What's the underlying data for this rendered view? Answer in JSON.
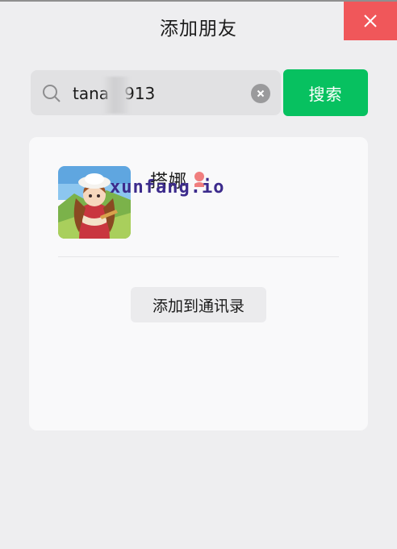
{
  "window": {
    "title": "添加朋友",
    "close_icon": "close-icon",
    "accent_close": "#f0575a"
  },
  "search": {
    "query": "tana   913",
    "button_label": "搜索",
    "accent": "#07c160"
  },
  "result": {
    "name": "搭娜",
    "gender_icon": "female-icon",
    "watermark": "xunfang.io",
    "add_button_label": "添加到通讯录"
  }
}
